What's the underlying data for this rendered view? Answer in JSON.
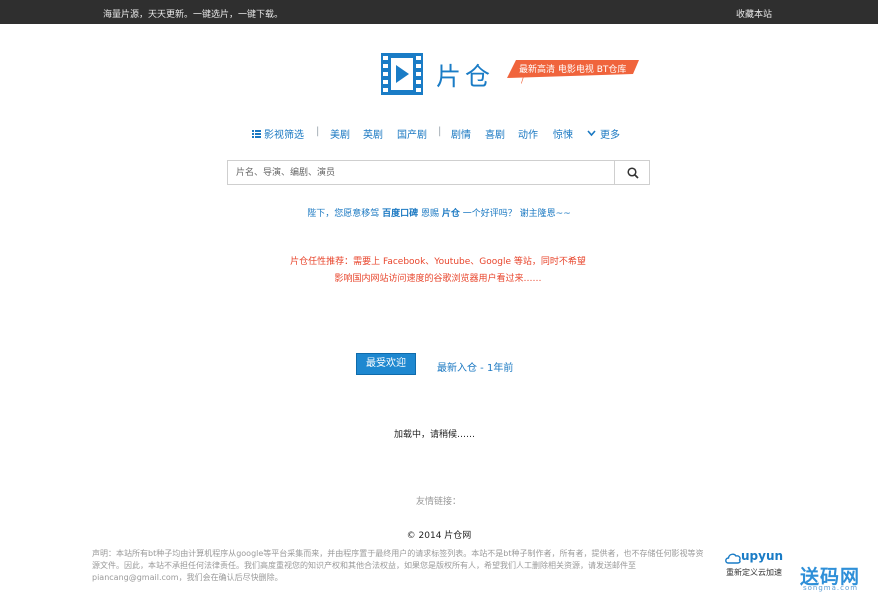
{
  "topbar": {
    "slogan": "海量片源，天天更新。一键选片，一键下载。",
    "bookmark": "收藏本站"
  },
  "logo": {
    "icon": "film-play-icon",
    "text": "片仓",
    "tagline": "最新高清 电影电视 BT仓库",
    "tagline_mark": "/"
  },
  "nav": {
    "filter": "影视筛选",
    "items": [
      "美剧",
      "英剧",
      "国产剧",
      "剧情",
      "喜剧",
      "动作",
      "惊悚"
    ],
    "separator": "|",
    "more": "更多"
  },
  "search": {
    "placeholder": "片名、导演、编剧、演员",
    "value": "",
    "button_icon": "search-icon"
  },
  "notice": {
    "part1": "陛下，您愿意移驾",
    "baidu_link": "百度口碑",
    "part2": "恩赐",
    "pc_link": "片仓",
    "part3": "一个好评吗？",
    "thanks_link": "谢主隆恩~~"
  },
  "recommendation": {
    "text": "片仓任性推荐：需要上 Facebook、Youtube、Google 等站，同时不希望影响国内网站访问速度的谷歌浏览器用户看过来……"
  },
  "tabs": {
    "active": "最受欢迎",
    "latest": "最新入仓 - 1年前"
  },
  "loading": "加载中，请稍候……",
  "friends": "友情链接：",
  "footer": {
    "copyright": "© 2014 片仓网",
    "disclaimer": "声明：本站所有bt种子均由计算机程序从google等平台采集而来，并由程序置于最终用户的请求标签列表。本站不是bt种子制作者，所有者，提供者，也不存储任何影视等资源文件。因此，本站不承担任何法律责任。我们高度重视您的知识产权和其他合法权益，如果您是版权所有人，希望我们人工删除相关资源，请发送邮件至piancang@gmail.com，我们会在确认后尽快删除。"
  },
  "upyun": {
    "name": "upyun",
    "subtitle": "重新定义云加速"
  },
  "watermark": {
    "text": "送码网",
    "url": "songma.com"
  },
  "colors": {
    "topbar_bg": "#2f2f2f",
    "link_blue": "#1a78c2",
    "accent_red": "#e8452c",
    "tagline_orange": "#f0643c"
  }
}
